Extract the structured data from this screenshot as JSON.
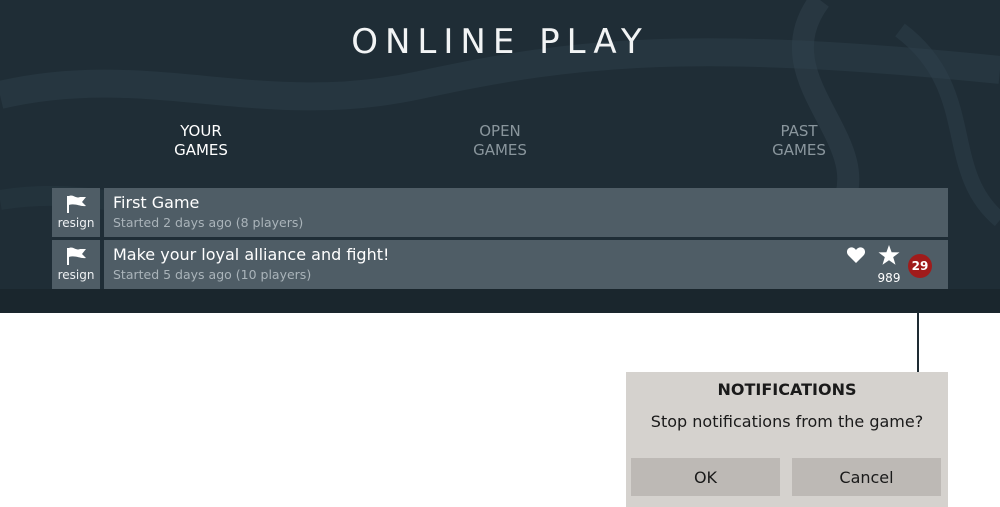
{
  "header": {
    "title": "ONLINE PLAY"
  },
  "tabs": [
    {
      "line1": "YOUR",
      "line2": "GAMES",
      "active": true
    },
    {
      "line1": "OPEN",
      "line2": "GAMES",
      "active": false
    },
    {
      "line1": "PAST",
      "line2": "GAMES",
      "active": false
    }
  ],
  "games": [
    {
      "resign_label": "resign",
      "title": "First Game",
      "subtitle": "Started 2 days ago (8 players)"
    },
    {
      "resign_label": "resign",
      "title": "Make your loyal alliance and fight!",
      "subtitle": "Started 5 days ago (10 players)",
      "star_count": "989",
      "notification_count": "29"
    }
  ],
  "dialog": {
    "title": "NOTIFICATIONS",
    "message": "Stop notifications from the game?",
    "ok_label": "OK",
    "cancel_label": "Cancel"
  },
  "colors": {
    "panel": "#1f2d36",
    "row": "#4f5d66",
    "badge": "#a01b1b",
    "dialog": "#d5d2ce",
    "button": "#bdb9b5"
  },
  "icons": {
    "resign": "flag-icon",
    "favorite": "heart-icon",
    "rating": "star-icon"
  }
}
